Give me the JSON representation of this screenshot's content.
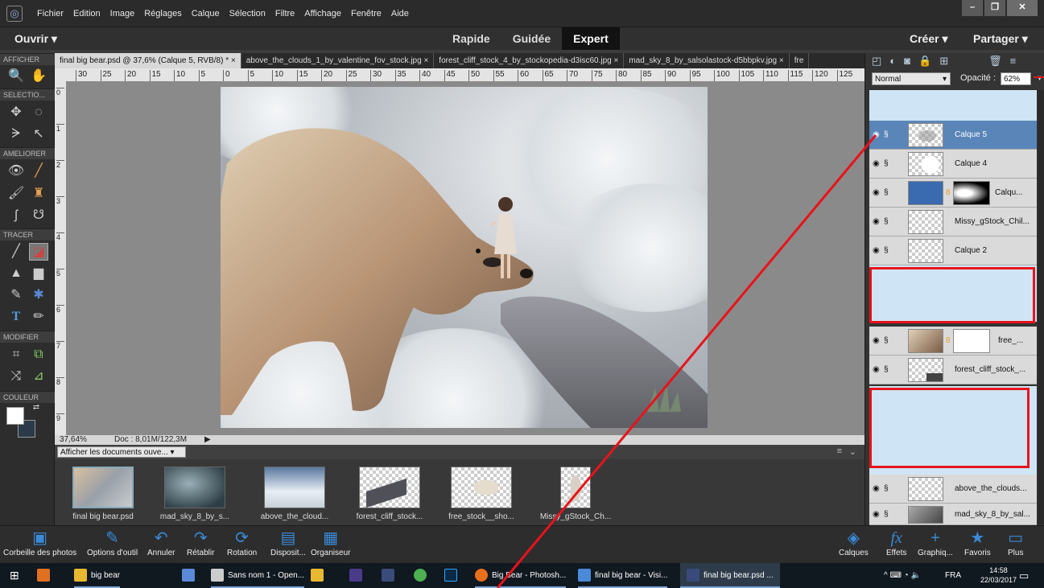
{
  "menubar": {
    "items": [
      "Fichier",
      "Edition",
      "Image",
      "Réglages",
      "Calque",
      "Sélection",
      "Filtre",
      "Affichage",
      "Fenêtre",
      "Aide"
    ]
  },
  "modebar": {
    "open": "Ouvrir",
    "modes": [
      "Rapide",
      "Guidée",
      "Expert"
    ],
    "active_mode": "Expert",
    "create": "Créer",
    "share": "Partager"
  },
  "toolbox": {
    "view_section": "AFFICHER",
    "select_section": "SELECTIO...",
    "enhance_section": "AMELIORER",
    "draw_section": "TRACER",
    "modify_section": "MODIFIER",
    "color_section": "COULEUR"
  },
  "tabs": [
    {
      "label": "final big bear.psd @ 37,6% (Calque 5, RVB/8) *",
      "active": true
    },
    {
      "label": "above_the_clouds_1_by_valentine_fov_stock.jpg",
      "active": false
    },
    {
      "label": "forest_cliff_stock_4_by_stockopedia-d3isc60.jpg",
      "active": false
    },
    {
      "label": "mad_sky_8_by_salsolastock-d5bbpkv.jpg",
      "active": false
    },
    {
      "label": "fre",
      "active": false
    }
  ],
  "ruler": {
    "h_ticks": [
      "30",
      "25",
      "20",
      "15",
      "10",
      "5",
      "0",
      "5",
      "10",
      "15",
      "20",
      "25",
      "30",
      "35",
      "40",
      "45",
      "50",
      "55",
      "60",
      "65",
      "70",
      "75",
      "80",
      "85",
      "90",
      "95",
      "100",
      "105",
      "110",
      "115",
      "120",
      "125"
    ],
    "v_ticks": [
      "0",
      "1",
      "2",
      "3",
      "4",
      "5",
      "6",
      "7",
      "8",
      "9"
    ]
  },
  "status": {
    "zoom": "37,64%",
    "doc": "Doc : 8,01M/122,3M"
  },
  "bin": {
    "dropdown": "Afficher les documents ouve...",
    "items": [
      "final big bear.psd",
      "mad_sky_8_by_s...",
      "above_the_cloud...",
      "forest_cliff_stock...",
      "free_stock__sho...",
      "Missy_gStock_Ch..."
    ]
  },
  "layers": {
    "blend_mode": "Normal",
    "opacity_label": "Opacité :",
    "opacity_value": "62%",
    "rows": [
      "Calque 5",
      "Calque 4",
      "Calqu...",
      "Missy_gStock_Chil...",
      "Calque 2",
      "free_...",
      "forest_cliff_stock_...",
      "above_the_clouds...",
      "mad_sky_8_by_sal..."
    ]
  },
  "bottombar": {
    "left": [
      "Corbeille des photos",
      "Options d'outil",
      "Annuler",
      "Rétablir",
      "Rotation",
      "Disposit...",
      "Organiseur"
    ],
    "right": [
      "Calques",
      "Effets",
      "Graphiq...",
      "Favoris",
      "Plus"
    ]
  },
  "taskbar": {
    "items": [
      "big bear",
      "Sans nom 1 - Open...",
      "Big Bear - Photosh...",
      "final big bear - Visi...",
      "final big bear.psd ..."
    ],
    "lang": "FRA",
    "time": "14:58",
    "date": "22/03/2017"
  },
  "colors": {
    "accent": "#5a85b8",
    "annotation_red": "#e8131a",
    "highlight_blue": "#cfe5f5",
    "brand_blue": "#3a8ad8"
  }
}
